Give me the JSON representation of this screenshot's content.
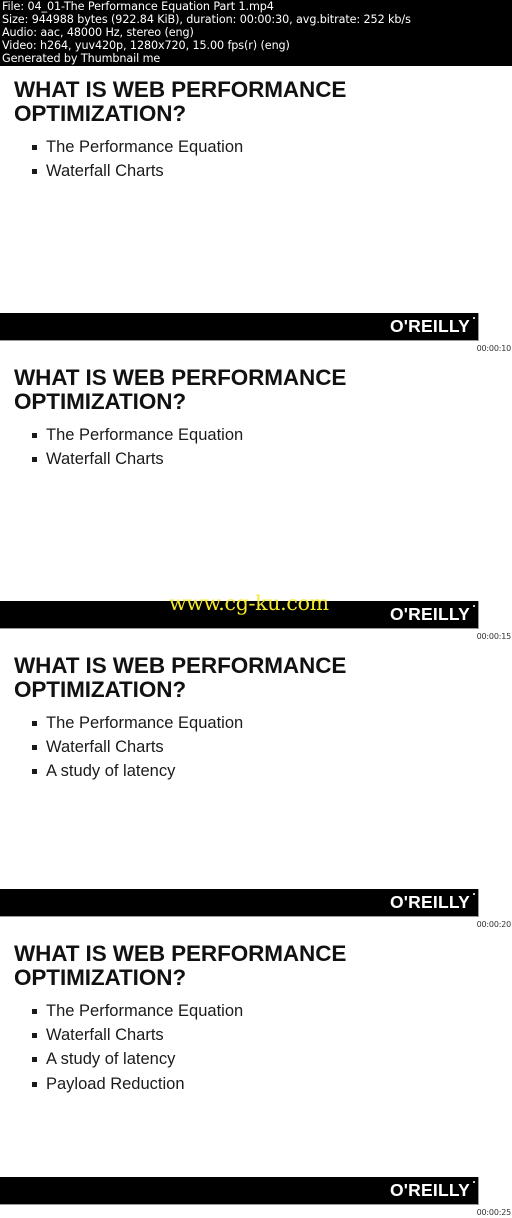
{
  "header": {
    "lines": [
      "File: 04_01-The Performance Equation  Part 1.mp4",
      "Size: 944988 bytes (922.84 KiB), duration: 00:00:30, avg.bitrate: 252 kb/s",
      "Audio: aac, 48000 Hz, stereo (eng)",
      "Video: h264, yuv420p, 1280x720, 15.00 fps(r) (eng)",
      "Generated by Thumbnail me"
    ]
  },
  "frames": [
    {
      "title_line1": "WHAT IS WEB PERFORMANCE",
      "title_line2": "OPTIMIZATION?",
      "bullets": [
        "The Performance Equation",
        "Waterfall Charts"
      ],
      "logo": "O'REILLY",
      "timestamp": "00:00:10"
    },
    {
      "title_line1": "WHAT IS WEB PERFORMANCE",
      "title_line2": "OPTIMIZATION?",
      "bullets": [
        "The Performance Equation",
        "Waterfall Charts"
      ],
      "logo": "O'REILLY",
      "timestamp": "00:00:15"
    },
    {
      "title_line1": "WHAT IS WEB PERFORMANCE",
      "title_line2": "OPTIMIZATION?",
      "bullets": [
        "The Performance Equation",
        "Waterfall Charts",
        "A study of latency"
      ],
      "logo": "O'REILLY",
      "timestamp": "00:00:20"
    },
    {
      "title_line1": "WHAT IS WEB PERFORMANCE",
      "title_line2": "OPTIMIZATION?",
      "bullets": [
        "The Performance Equation",
        "Waterfall Charts",
        "A study of latency",
        "Payload Reduction"
      ],
      "logo": "O'REILLY",
      "timestamp": "00:00:25"
    }
  ],
  "watermark": {
    "text": "www.cg-ku.com",
    "color": "#f5ea2a"
  },
  "colors": {
    "header_bg": "#000000",
    "slide_bg": "#ffffff",
    "footer_bar": "#000000"
  }
}
